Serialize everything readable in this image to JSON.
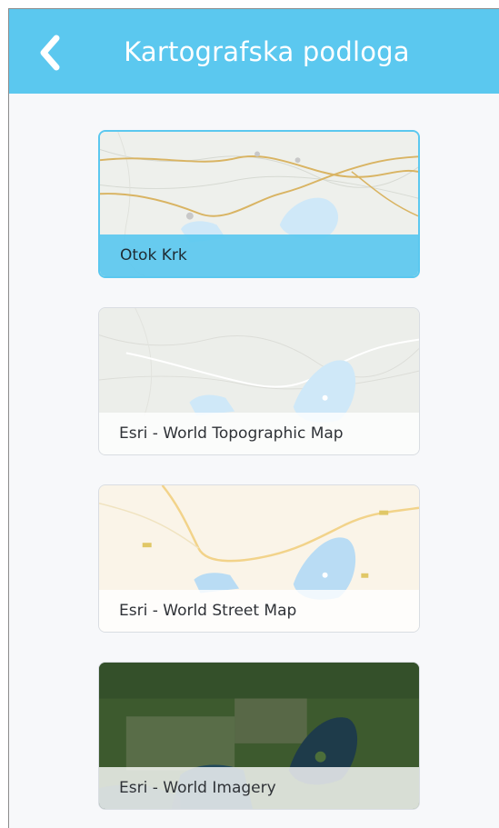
{
  "header": {
    "title": "Kartografska podloga",
    "back_icon": "chevron-left-icon",
    "background_color": "#5bc8ef"
  },
  "basemaps": [
    {
      "label": "Otok Krk",
      "selected": true
    },
    {
      "label": "Esri - World Topographic Map",
      "selected": false
    },
    {
      "label": "Esri - World Street Map",
      "selected": false
    },
    {
      "label": "Esri - World Imagery",
      "selected": false
    }
  ],
  "colors": {
    "accent": "#5bc8ef",
    "water": "#cfe8f8",
    "imagery_land": "#3d5a2e",
    "imagery_sea": "#1e3b4a"
  }
}
